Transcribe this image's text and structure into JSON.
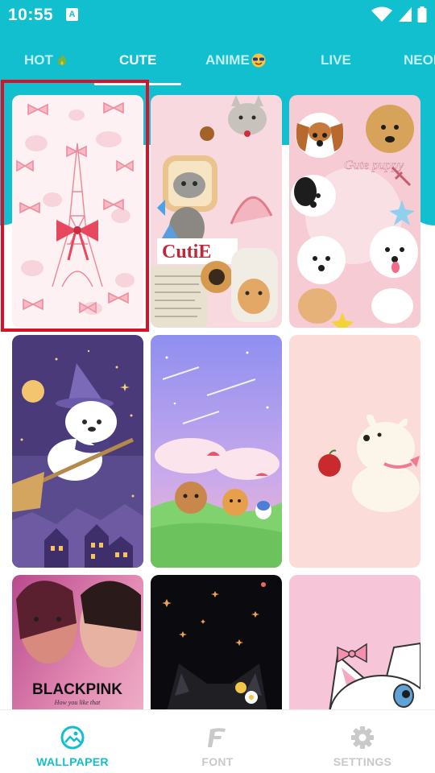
{
  "status_bar": {
    "time": "10:55",
    "notification_icon": "a-icon"
  },
  "tabs": [
    {
      "label": "HOT",
      "icon": "fire-icon",
      "active": false
    },
    {
      "label": "CUTE",
      "icon": "",
      "active": true
    },
    {
      "label": "ANIME",
      "icon": "sunglasses-emoji-icon",
      "active": false
    },
    {
      "label": "LIVE",
      "icon": "",
      "active": false
    },
    {
      "label": "NEON",
      "icon": "",
      "active": false
    }
  ],
  "wallpapers": [
    {
      "name": "pink bows eiffel tower",
      "selected": true
    },
    {
      "name": "cute cats collage"
    },
    {
      "name": "cute puppies"
    },
    {
      "name": "witch bear on broom"
    },
    {
      "name": "bears picnic sky"
    },
    {
      "name": "white puppy with apple"
    },
    {
      "name": "blackpink"
    },
    {
      "name": "black cat with flowers"
    },
    {
      "name": "white kitten with bow"
    }
  ],
  "card_texts": {
    "cutie": "CutiE",
    "gute_puppy": "Gute puppy",
    "blackpink": "BLACKPINK",
    "blackpink_sub": "How you like that"
  },
  "bottom_nav": {
    "items": [
      {
        "label": "WALLPAPER",
        "icon": "wallpaper-icon",
        "active": true
      },
      {
        "label": "FONT",
        "icon": "font-icon",
        "active": false
      },
      {
        "label": "SETTINGS",
        "icon": "gear-icon",
        "active": false
      }
    ]
  },
  "colors": {
    "accent": "#12bfcf",
    "selection": "#d8102a",
    "inactive": "#c9c9c9"
  }
}
